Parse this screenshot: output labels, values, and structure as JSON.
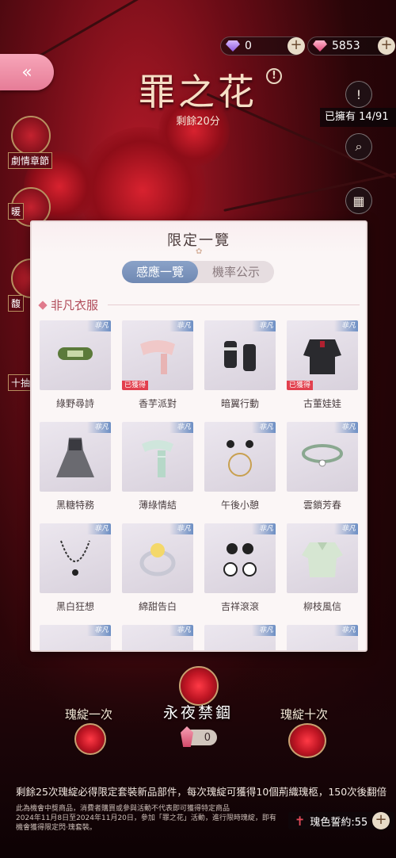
{
  "currency": {
    "purple_gem": "0",
    "pink_gem": "5853"
  },
  "header": {
    "logo_title": "罪之花",
    "logo_subtitle": "剩餘20分",
    "owned_count": "已擁有 14/91"
  },
  "left_menu": [
    {
      "label": "劇情章節"
    },
    {
      "label": "暖"
    },
    {
      "label": "馥"
    },
    {
      "label": "十抽"
    }
  ],
  "panel": {
    "title": "限定一覽",
    "tabs": [
      {
        "label": "感應一覽",
        "active": true
      },
      {
        "label": "機率公示",
        "active": false
      }
    ],
    "section_title": "非凡衣服",
    "tag_label": "非凡",
    "obtained_label": "已獲得",
    "items": [
      {
        "name": "綠野尋詩",
        "obtained": false,
        "icon": "headband-icon"
      },
      {
        "name": "香芋派對",
        "obtained": true,
        "icon": "scarf-icon"
      },
      {
        "name": "暗翼行動",
        "obtained": false,
        "icon": "gloves-icon"
      },
      {
        "name": "古董娃娃",
        "obtained": true,
        "icon": "jacket-icon"
      },
      {
        "name": "黑糖特務",
        "obtained": false,
        "icon": "dress-icon"
      },
      {
        "name": "薄綠情結",
        "obtained": false,
        "icon": "striped-scarf-icon"
      },
      {
        "name": "午後小憩",
        "obtained": false,
        "icon": "earrings-icon"
      },
      {
        "name": "雲鎖芳春",
        "obtained": false,
        "icon": "choker-icon"
      },
      {
        "name": "黑白狂想",
        "obtained": false,
        "icon": "necklace-icon"
      },
      {
        "name": "綿甜告白",
        "obtained": false,
        "icon": "ring-icon"
      },
      {
        "name": "吉祥滾滾",
        "obtained": false,
        "icon": "panda-earrings-icon"
      },
      {
        "name": "柳枝風信",
        "obtained": false,
        "icon": "blouse-icon"
      }
    ]
  },
  "bottom": {
    "pull_one_label": "瑰綻一次",
    "pull_ten_label": "瑰綻十次",
    "banner_title": "永夜禁錮",
    "key_count": "0",
    "notice": "剩餘25次瑰綻必得限定套裝新品部件，每次瑰綻可獲得10個荊織瑰柩，150次後翻倍",
    "fine_print": [
      "此為機會中獎商品，消費者購買或參與活動不代表即可獲得特定商品",
      "2024年11月8日至2024年11月20日，參加「罪之花」活動，進行限時瑰綻，即有",
      "機會獲得限定閃‧瑰套裝。"
    ],
    "pledge_label": "瑰色誓約:55"
  }
}
